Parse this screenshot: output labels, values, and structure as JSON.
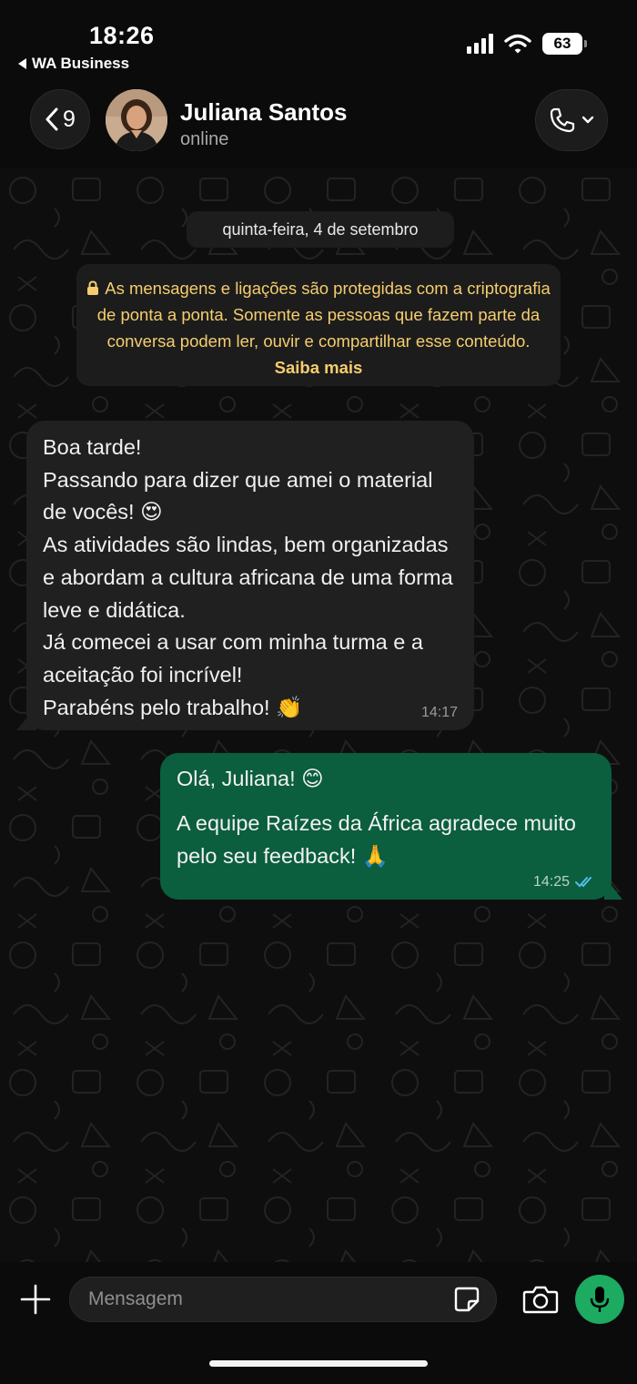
{
  "status_bar": {
    "time": "18:26",
    "back_app": "WA Business",
    "battery": "63"
  },
  "header": {
    "back_count": "9",
    "contact_name": "Juliana Santos",
    "presence": "online"
  },
  "chat": {
    "date": "quinta-feira, 4 de setembro",
    "encryption_notice": "As mensagens e ligações são protegidas com a criptografia de ponta a ponta. Somente as pessoas que fazem parte da conversa podem ler, ouvir e compartilhar esse conteúdo.",
    "learn_more": "Saiba mais",
    "messages": [
      {
        "direction": "incoming",
        "text": "Boa tarde!\nPassando para dizer que amei o material de vocês! 😍\nAs atividades são lindas, bem organizadas e abordam a cultura africana de uma forma leve e didática.\nJá comecei a usar com minha turma e a aceitação foi incrível!\nParabéns pelo trabalho! 👏",
        "time": "14:17"
      },
      {
        "direction": "outgoing",
        "line1": "Olá, Juliana! 😊",
        "line2": "A equipe Raízes da África agradece muito pelo seu feedback! 🙏",
        "time": "14:25",
        "status": "read"
      }
    ]
  },
  "composer": {
    "placeholder": "Mensagem"
  },
  "colors": {
    "incoming_bubble": "#202020",
    "outgoing_bubble": "#0b5e3e",
    "accent_green": "#1daa61",
    "notice_text": "#f5cd6e",
    "read_ticks": "#53bdeb"
  },
  "icons": [
    "back-chevron-icon",
    "phone-icon",
    "chevron-down-icon",
    "lock-icon",
    "double-check-icon",
    "plus-icon",
    "sticker-icon",
    "camera-icon",
    "mic-icon",
    "signal-icon",
    "wifi-icon",
    "battery-icon"
  ]
}
